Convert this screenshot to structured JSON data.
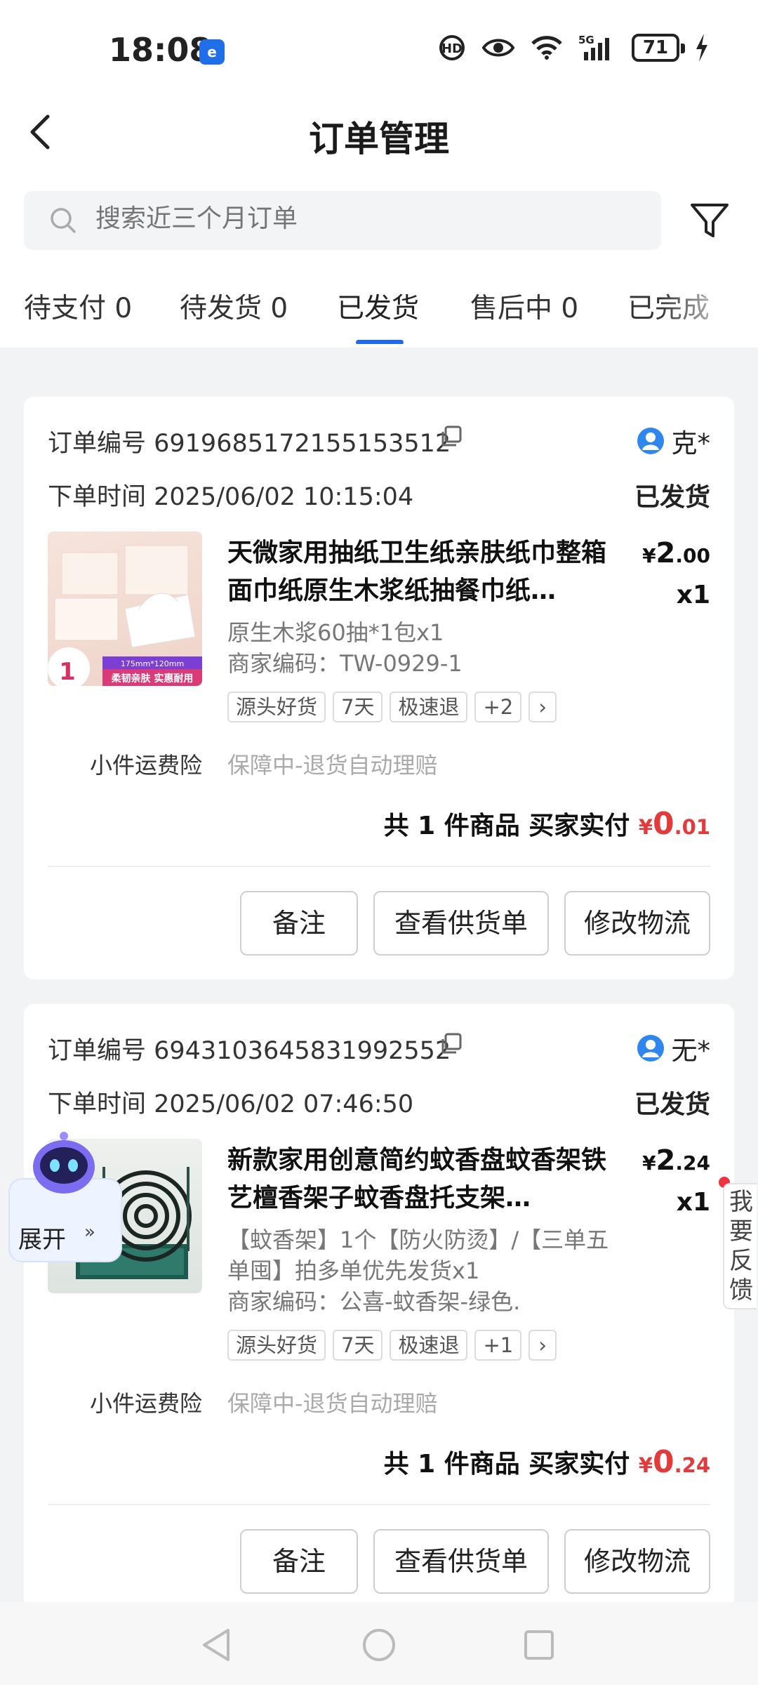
{
  "status_bar": {
    "time": "18:08",
    "battery": "71"
  },
  "header": {
    "title": "订单管理"
  },
  "search": {
    "placeholder": "搜索近三个月订单"
  },
  "tabs": [
    {
      "label": "待支付 0"
    },
    {
      "label": "待发货 0"
    },
    {
      "label": "已发货",
      "active": true
    },
    {
      "label": "售后中 0"
    },
    {
      "label": "已完成"
    }
  ],
  "colors": {
    "accent": "#1f6be8",
    "price_red": "#e33b3b"
  },
  "orders": [
    {
      "order_no": "订单编号 6919685172155153512",
      "order_time": "下单时间 2025/06/02 10:15:04",
      "buyer": "克*",
      "status": "已发货",
      "product_title": "天微家用抽纸卫生纸亲肤纸巾整箱面巾纸原生木浆纸抽餐巾纸…",
      "price_symbol": "¥",
      "price_int": "2",
      "price_dec": ".00",
      "qty": "x1",
      "spec": "原生木浆60抽*1包x1",
      "merchant_code": "商家编码：TW-0929-1",
      "tags": [
        "源头好货",
        "7天",
        "极速退",
        "+2"
      ],
      "insurance_label": "小件运费险",
      "insurance_value": "保障中-退货自动理赔",
      "total_label": "共 1 件商品   买家实付",
      "total_symbol": "¥",
      "total_int": "0",
      "total_dec": ".01",
      "buttons": [
        "备注",
        "查看供货单",
        "修改物流"
      ],
      "thumb_badge": "1",
      "thumb_caption": "柔韧亲肤 实惠耐用"
    },
    {
      "order_no": "订单编号 6943103645831992552",
      "order_time": "下单时间 2025/06/02 07:46:50",
      "buyer": "无*",
      "status": "已发货",
      "product_title": " 新款家用创意简约蚊香盘蚊香架铁艺檀香架子蚊香盘托支架…",
      "price_symbol": "¥",
      "price_int": "2",
      "price_dec": ".24",
      "qty": "x1",
      "spec": "【蚊香架】1个【防火防烫】/【三单五单囤】拍多单优先发货x1",
      "merchant_code": "商家编码：公喜-蚊香架-绿色.",
      "tags": [
        "源头好货",
        "7天",
        "极速退",
        "+1"
      ],
      "insurance_label": "小件运费险",
      "insurance_value": "保障中-退货自动理赔",
      "total_label": "共 1 件商品   买家实付",
      "total_symbol": "¥",
      "total_int": "0",
      "total_dec": ".24",
      "buttons": [
        "备注",
        "查看供货单",
        "修改物流"
      ]
    }
  ],
  "assistant": {
    "label": "展开"
  },
  "feedback": {
    "label": "我要反馈"
  }
}
